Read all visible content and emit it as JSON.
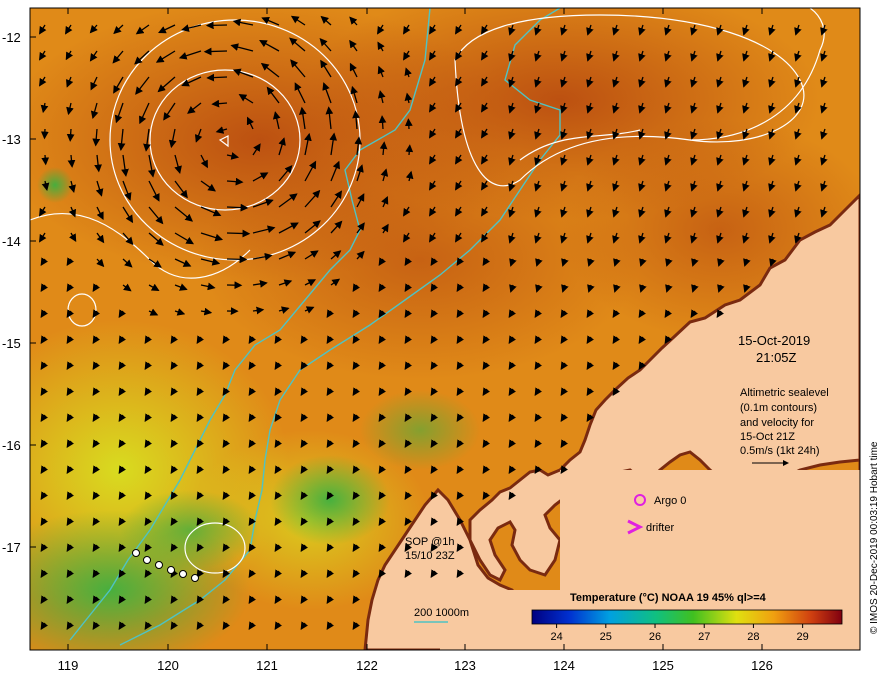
{
  "map": {
    "lat_ticks": [
      "-12",
      "-13",
      "-14",
      "-15",
      "-16",
      "-17"
    ],
    "lon_ticks": [
      "119",
      "120",
      "121",
      "122",
      "123",
      "124",
      "125",
      "126"
    ],
    "datetime": {
      "date": "15-Oct-2019",
      "time": "21:05Z"
    },
    "altimetry_note": [
      "Altimetric sealevel",
      "(0.1m contours)",
      "and velocity for",
      "15-Oct 21Z",
      "0.5m/s (1kt 24h)"
    ],
    "legend": {
      "argo": "Argo 0",
      "drifter": "drifter",
      "sop_lines": [
        "SOP @1h",
        "15/10 23Z"
      ],
      "isobath": "200  1000m"
    },
    "colorbar": {
      "title": "Temperature (°C) NOAA 19 45% ql>=4",
      "ticks": [
        "24",
        "25",
        "26",
        "27",
        "28",
        "29"
      ],
      "range": [
        23.5,
        29.8
      ]
    },
    "credit": "© IMOS 20-Dec-2019 00:03:19 Hobart time",
    "colors": {
      "land": "#f8c9a0",
      "isobath": "#4fc3c3",
      "contour": "#ffffff",
      "argo": "#e020e0",
      "sst_warm": "#c05010",
      "sst_mid": "#e89018",
      "sst_cool": "#60c030"
    }
  }
}
